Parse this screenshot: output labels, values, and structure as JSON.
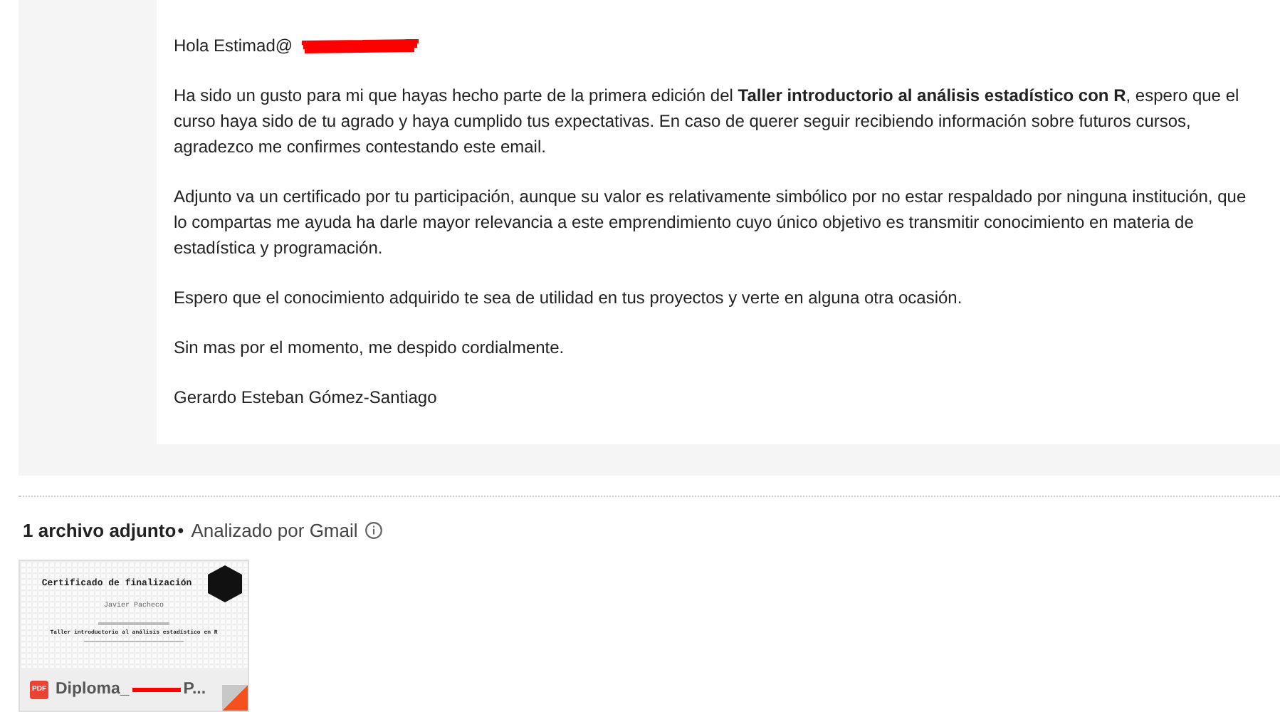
{
  "email": {
    "greeting": "Hola Estimad@",
    "greeting_redacted": true,
    "paragraphs": [
      "Ha sido un gusto para mi que hayas hecho parte de la primera edición del **Taller introductorio al análisis estadístico con R**, espero que el curso haya sido de tu agrado y haya cumplido tus expectativas. En caso de querer seguir recibiendo información sobre futuros cursos, agradezco me confirmes contestando este email.",
      "Adjunto va un certificado por tu participación, aunque su valor es relativamente simbólico por no estar respaldado por ninguna institución, que lo compartas me ayuda ha darle mayor relevancia a este emprendimiento cuyo único objetivo es transmitir conocimiento en materia de estadística y programación.",
      "Espero que el conocimiento adquirido te sea de utilidad en tus proyectos y verte en alguna otra ocasión.",
      "Sin mas por el momento, me despido cordialmente.",
      "Gerardo Esteban Gómez-Santiago"
    ]
  },
  "attachments": {
    "count_label": "1 archivo adjunto",
    "separator": "•",
    "scan_label": "Analizado por Gmail",
    "files": [
      {
        "badge": "PDF",
        "name": "Diploma_",
        "name_redacted": true,
        "name_end": "P...",
        "preview": {
          "title": "Certificado de finalización",
          "recipient": "Javier Pacheco",
          "course": "Taller introductorio al análisis estadístico en R"
        }
      }
    ]
  }
}
